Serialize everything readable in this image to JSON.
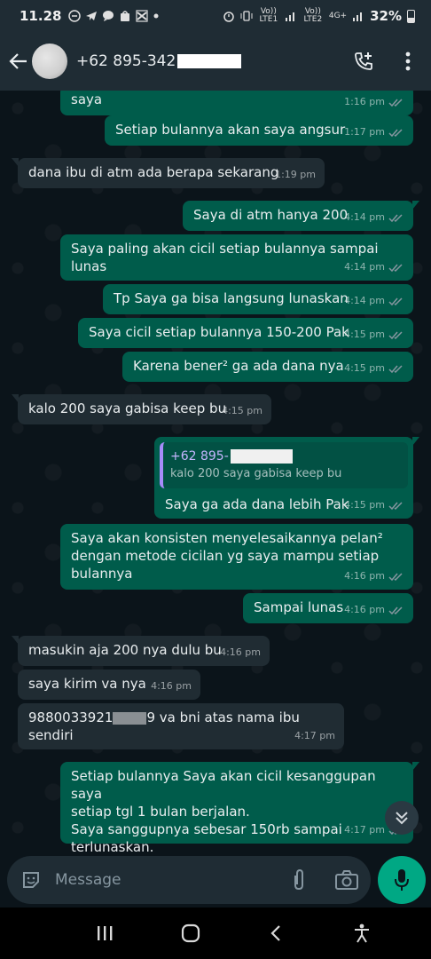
{
  "status_bar": {
    "time": "11.28",
    "notif_icons": [
      "circle-minus-icon",
      "telegram-icon",
      "chat-icon",
      "shop-icon",
      "capcut-icon",
      "dot-icon"
    ],
    "net1": "Vo)) LTE1",
    "net2": "Vo)) LTE2",
    "net_type": "4G+",
    "battery": "32%"
  },
  "header": {
    "contact_name": "+62 895-342"
  },
  "messages": [
    {
      "dir": "out",
      "text": "saya",
      "time": "1:16 pm"
    },
    {
      "dir": "out",
      "text": "Setiap bulannya akan saya angsur",
      "time": "1:17 pm"
    },
    {
      "dir": "in",
      "text": "dana ibu di atm ada berapa sekarang",
      "time": "1:19 pm"
    },
    {
      "dir": "out",
      "text": "Saya di atm hanya 200",
      "time": "4:14 pm"
    },
    {
      "dir": "out",
      "text": "Saya paling akan cicil setiap bulannya sampai lunas",
      "time": "4:14 pm"
    },
    {
      "dir": "out",
      "text": "Tp Saya ga bisa langsung lunaskan",
      "time": "4:14 pm"
    },
    {
      "dir": "out",
      "text": "Saya cicil setiap bulannya 150-200 Pak",
      "time": "4:15 pm"
    },
    {
      "dir": "out",
      "text": "Karena bener² ga ada dana nya",
      "time": "4:15 pm"
    },
    {
      "dir": "in",
      "text": "kalo 200 saya gabisa keep bu",
      "time": "4:15 pm"
    },
    {
      "dir": "out",
      "quote_name": "+62 895-",
      "quote_text": "kalo 200 saya gabisa keep bu",
      "text": "Saya ga ada dana lebih Pak",
      "time": "4:15 pm"
    },
    {
      "dir": "out",
      "text": "Saya akan konsisten menyelesaikannya pelan²\ndengan metode cicilan yg saya mampu setiap\nbulannya",
      "time": "4:16 pm"
    },
    {
      "dir": "out",
      "text": "Sampai lunas",
      "time": "4:16 pm"
    },
    {
      "dir": "in",
      "text": "masukin aja 200 nya dulu bu",
      "time": "4:16 pm"
    },
    {
      "dir": "in",
      "text": "saya kirim va nya",
      "time": "4:16 pm"
    },
    {
      "dir": "in",
      "text_pre": "9880033921",
      "text_post": "9 va bni atas nama ibu sendiri",
      "time": "4:17 pm"
    },
    {
      "dir": "out",
      "text": "Setiap bulannya Saya akan cicil kesanggupan saya\nsetiap tgl 1 bulan berjalan.\nSaya sanggupnya sebesar 150rb sampai\nterlunaskan.",
      "time": "4:17 pm"
    }
  ],
  "composer": {
    "placeholder": "Message"
  },
  "colors": {
    "out_bubble": "#005c4b",
    "in_bubble": "#202c33",
    "accent": "#00a884",
    "read_tick": "#8696a0"
  }
}
